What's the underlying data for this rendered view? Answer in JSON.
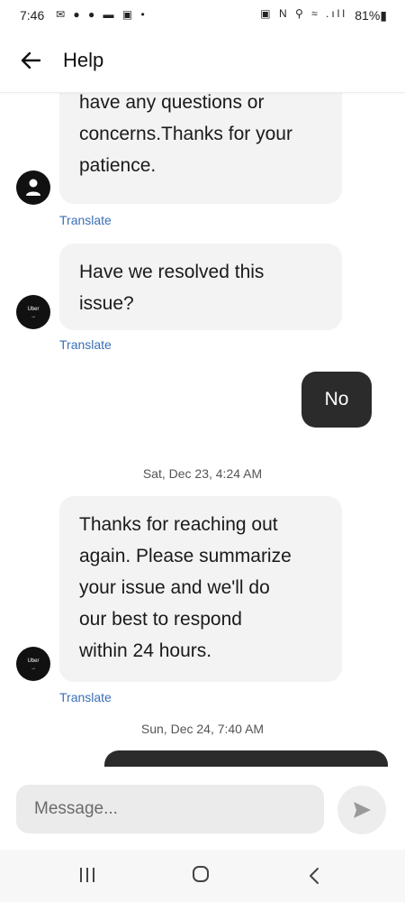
{
  "status_bar": {
    "time": "7:46",
    "left_icons": "✉ ● ● ▬ ▣ •",
    "right_icons": "▣ N ⚲ ≈ .ıll",
    "battery": "81%▮"
  },
  "header": {
    "title": "Help"
  },
  "messages": {
    "m1": {
      "lines": [
        "have any questions or",
        "concerns.Thanks for your",
        "patience."
      ]
    },
    "m2": {
      "lines": [
        "Have we resolved this",
        "issue?"
      ]
    },
    "m3": {
      "text": "No"
    },
    "m4": {
      "lines": [
        "Thanks for reaching out",
        "again. Please summarize",
        "your issue and we'll do",
        "our best to respond",
        "within 24 hours."
      ]
    }
  },
  "translate_label": "Translate",
  "avatar_uber_text": "Uber",
  "timestamps": [
    "Sat, Dec 23, 4:24 AM",
    "Sun, Dec 24, 7:40 AM"
  ],
  "composer": {
    "placeholder": "Message..."
  },
  "icons": {
    "back": "arrow-left-icon",
    "send": "send-icon",
    "user_avatar": "user-icon",
    "nav_recent": "recent-apps-icon",
    "nav_home": "home-icon",
    "nav_back": "back-chevron-icon"
  },
  "colors": {
    "incoming_bubble": "#f3f3f3",
    "outgoing_bubble": "#2b2b2b",
    "translate_link": "#3a6fb8"
  }
}
